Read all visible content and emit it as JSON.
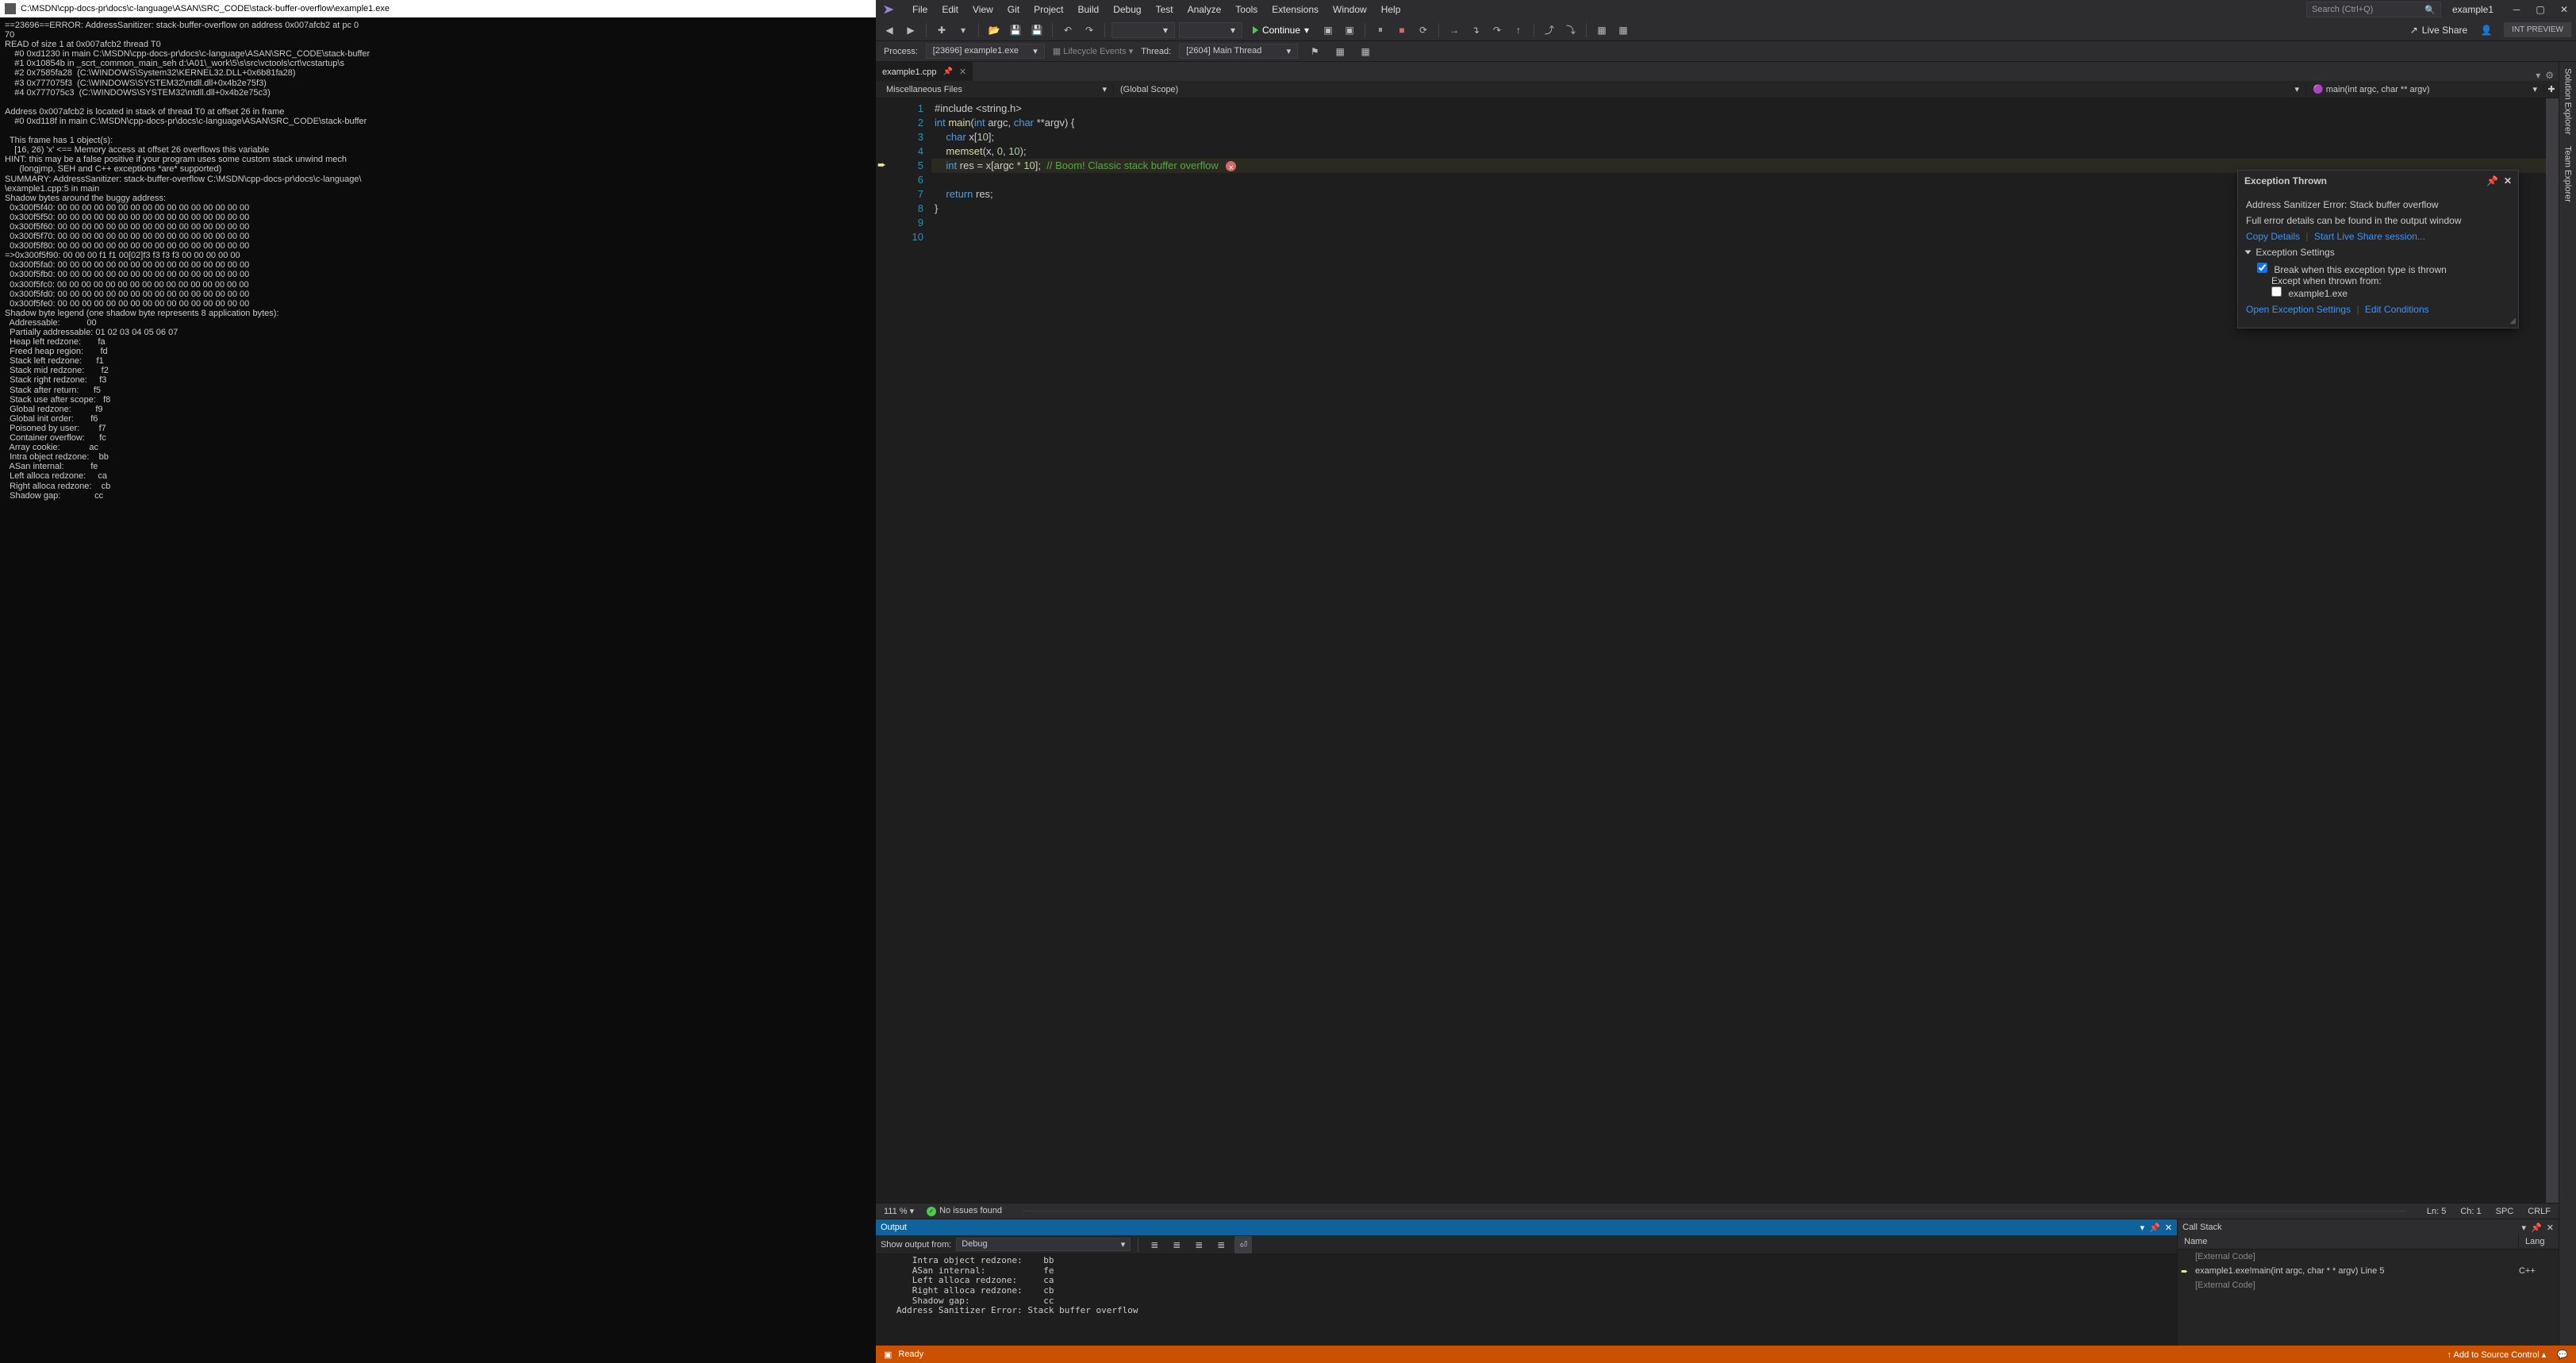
{
  "console": {
    "title": "C:\\MSDN\\cpp-docs-pr\\docs\\c-language\\ASAN\\SRC_CODE\\stack-buffer-overflow\\example1.exe",
    "body": "==23696==ERROR: AddressSanitizer: stack-buffer-overflow on address 0x007afcb2 at pc 0\n70\nREAD of size 1 at 0x007afcb2 thread T0\n    #0 0xd1230 in main C:\\MSDN\\cpp-docs-pr\\docs\\c-language\\ASAN\\SRC_CODE\\stack-buffer\n    #1 0x10854b in _scrt_common_main_seh d:\\A01\\_work\\5\\s\\src\\vctools\\crt\\vcstartup\\s\n    #2 0x7585fa28  (C:\\WINDOWS\\System32\\KERNEL32.DLL+0x6b81fa28)\n    #3 0x777075f3  (C:\\WINDOWS\\SYSTEM32\\ntdll.dll+0x4b2e75f3)\n    #4 0x777075c3  (C:\\WINDOWS\\SYSTEM32\\ntdll.dll+0x4b2e75c3)\n\nAddress 0x007afcb2 is located in stack of thread T0 at offset 26 in frame\n    #0 0xd118f in main C:\\MSDN\\cpp-docs-pr\\docs\\c-language\\ASAN\\SRC_CODE\\stack-buffer\n\n  This frame has 1 object(s):\n    [16, 26) 'x' <== Memory access at offset 26 overflows this variable\nHINT: this may be a false positive if your program uses some custom stack unwind mech\n      (longjmp, SEH and C++ exceptions *are* supported)\nSUMMARY: AddressSanitizer: stack-buffer-overflow C:\\MSDN\\cpp-docs-pr\\docs\\c-language\\\n\\example1.cpp:5 in main\nShadow bytes around the buggy address:\n  0x300f5f40: 00 00 00 00 00 00 00 00 00 00 00 00 00 00 00 00\n  0x300f5f50: 00 00 00 00 00 00 00 00 00 00 00 00 00 00 00 00\n  0x300f5f60: 00 00 00 00 00 00 00 00 00 00 00 00 00 00 00 00\n  0x300f5f70: 00 00 00 00 00 00 00 00 00 00 00 00 00 00 00 00\n  0x300f5f80: 00 00 00 00 00 00 00 00 00 00 00 00 00 00 00 00\n=>0x300f5f90: 00 00 00 f1 f1 00[02]f3 f3 f3 f3 00 00 00 00 00\n  0x300f5fa0: 00 00 00 00 00 00 00 00 00 00 00 00 00 00 00 00\n  0x300f5fb0: 00 00 00 00 00 00 00 00 00 00 00 00 00 00 00 00\n  0x300f5fc0: 00 00 00 00 00 00 00 00 00 00 00 00 00 00 00 00\n  0x300f5fd0: 00 00 00 00 00 00 00 00 00 00 00 00 00 00 00 00\n  0x300f5fe0: 00 00 00 00 00 00 00 00 00 00 00 00 00 00 00 00\nShadow byte legend (one shadow byte represents 8 application bytes):\n  Addressable:           00\n  Partially addressable: 01 02 03 04 05 06 07\n  Heap left redzone:       fa\n  Freed heap region:       fd\n  Stack left redzone:      f1\n  Stack mid redzone:       f2\n  Stack right redzone:     f3\n  Stack after return:      f5\n  Stack use after scope:   f8\n  Global redzone:          f9\n  Global init order:       f6\n  Poisoned by user:        f7\n  Container overflow:      fc\n  Array cookie:            ac\n  Intra object redzone:    bb\n  ASan internal:           fe\n  Left alloca redzone:     ca\n  Right alloca redzone:    cb\n  Shadow gap:              cc"
  },
  "menu": [
    "File",
    "Edit",
    "View",
    "Git",
    "Project",
    "Build",
    "Debug",
    "Test",
    "Analyze",
    "Tools",
    "Extensions",
    "Window",
    "Help"
  ],
  "search_placeholder": "Search (Ctrl+Q)",
  "solution_name": "example1",
  "int_preview": "INT PREVIEW",
  "continue_label": "Continue",
  "live_share": "Live Share",
  "process": {
    "label": "Process:",
    "value": "[23696] example1.exe"
  },
  "lifecycle": "Lifecycle Events",
  "thread": {
    "label": "Thread:",
    "value": "[2604] Main Thread"
  },
  "filetab": "example1.cpp",
  "nav": {
    "scope1": "Miscellaneous Files",
    "scope2": "(Global Scope)",
    "scope3": "main(int argc, char ** argv)"
  },
  "rightrail": [
    "Solution Explorer",
    "Team Explorer"
  ],
  "code": {
    "lines": [
      "#include <string.h>",
      "int main(int argc, char **argv) {",
      "    char x[10];",
      "    memset(x, 0, 10);",
      "    int res = x[argc * 10];  // Boom! Classic stack buffer overflow",
      "",
      "    return res;",
      "}",
      "",
      ""
    ]
  },
  "exception": {
    "title": "Exception Thrown",
    "message": "Address Sanitizer Error: Stack buffer overflow",
    "detail": "Full error details can be found in the output window",
    "copy": "Copy Details",
    "start_ls": "Start Live Share session...",
    "settings_hdr": "Exception Settings",
    "break_label": "Break when this exception type is thrown",
    "except_label": "Except when thrown from:",
    "module": "example1.exe",
    "open_settings": "Open Exception Settings",
    "edit_cond": "Edit Conditions"
  },
  "edstatus": {
    "zoom": "111 %",
    "issues": "No issues found",
    "ln": "Ln: 5",
    "ch": "Ch: 1",
    "spc": "SPC",
    "crlf": "CRLF"
  },
  "output": {
    "title": "Output",
    "show_label": "Show output from:",
    "show_value": "Debug",
    "body": "      Intra object redzone:    bb\n      ASan internal:           fe\n      Left alloca redzone:     ca\n      Right alloca redzone:    cb\n      Shadow gap:              cc\n   Address Sanitizer Error: Stack buffer overflow"
  },
  "callstack": {
    "title": "Call Stack",
    "col_name": "Name",
    "col_lang": "Lang",
    "rows": [
      {
        "name": "[External Code]",
        "lang": "",
        "ext": true,
        "ptr": false
      },
      {
        "name": "example1.exe!main(int argc, char * * argv) Line 5",
        "lang": "C++",
        "ext": false,
        "ptr": true
      },
      {
        "name": "[External Code]",
        "lang": "",
        "ext": true,
        "ptr": false
      }
    ]
  },
  "statusbar": {
    "ready": "Ready",
    "add_source": "Add to Source Control"
  }
}
